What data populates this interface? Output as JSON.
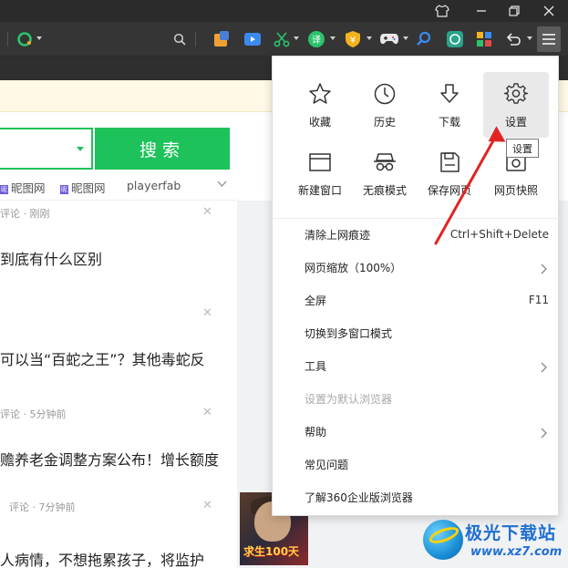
{
  "toolbar": {
    "icons": [
      "home-shirt-icon",
      "restore-icon",
      "close-icon"
    ]
  },
  "search": {
    "button_label": "搜索"
  },
  "quick_links": [
    {
      "label": "昵图网"
    },
    {
      "label": "昵图网"
    },
    {
      "label": "playerfab"
    }
  ],
  "feed": {
    "items": [
      {
        "meta": "评论 · 刚刚",
        "title": "到底有什么区别"
      },
      {
        "meta": "",
        "title": "可以当“百蛇之王”？其他毒蛇反"
      },
      {
        "meta": "评论 · 5分钟前",
        "title": "赡养老金调整方案公布！增长额度"
      },
      {
        "meta": "评论 · 7分钟前",
        "title": "人病情，不想拖累孩子，将监护"
      }
    ],
    "thumb_caption": "求生100天"
  },
  "menu": {
    "grid": [
      {
        "label": "收藏",
        "icon": "star-icon"
      },
      {
        "label": "历史",
        "icon": "clock-icon"
      },
      {
        "label": "下载",
        "icon": "download-icon"
      },
      {
        "label": "设置",
        "icon": "gear-icon",
        "active": true
      },
      {
        "label": "新建窗口",
        "icon": "new-window-icon"
      },
      {
        "label": "无痕模式",
        "icon": "incognito-icon"
      },
      {
        "label": "保存网页",
        "icon": "save-page-icon"
      },
      {
        "label": "网页快照",
        "icon": "snapshot-icon"
      }
    ],
    "items": [
      {
        "label": "清除上网痕迹",
        "shortcut": "Ctrl+Shift+Delete"
      },
      {
        "label": "网页缩放（100%）",
        "submenu": true
      },
      {
        "label": "全屏",
        "shortcut": "F11"
      },
      {
        "label": "切换到多窗口模式"
      },
      {
        "label": "工具",
        "submenu": true
      },
      {
        "label": "设置为默认浏览器",
        "disabled": true
      },
      {
        "label": "帮助",
        "submenu": true
      },
      {
        "label": "常见问题"
      },
      {
        "label": "了解360企业版浏览器"
      }
    ],
    "tooltip": "设置"
  },
  "watermark": {
    "title": "极光下载站",
    "url": "www.xz7.com"
  },
  "colors": {
    "accent_green": "#1ec25a",
    "arrow_red": "#e02424",
    "watermark_blue": "#1f6fd1"
  }
}
